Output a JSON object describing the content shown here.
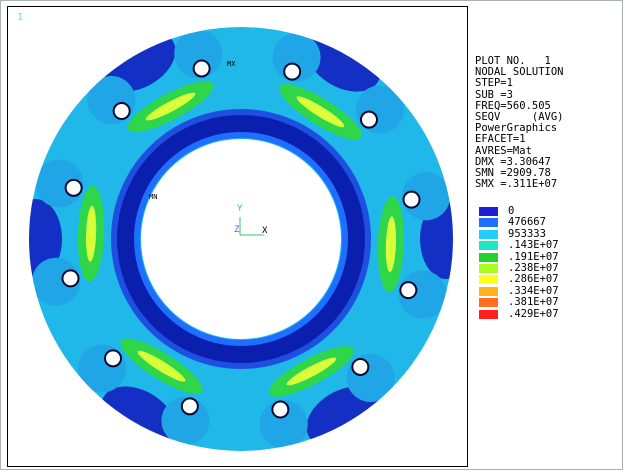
{
  "window_number": "1",
  "annotations": {
    "max_label": "MX",
    "min_label": "MN"
  },
  "axes": {
    "y_label": "Y",
    "z_label": "Z",
    "x_label": "X"
  },
  "info_lines": [
    "PLOT NO.   1",
    "NODAL SOLUTION",
    "STEP=1",
    "SUB =3",
    "FREQ=560.505",
    "SEQV     (AVG)",
    "PowerGraphics",
    "EFACET=1",
    "AVRES=Mat",
    "DMX =3.30647",
    "SMN =2909.78",
    "SMX =.311E+07"
  ],
  "legend": [
    {
      "label": "0",
      "color": "#1f1fd6"
    },
    {
      "label": "476667",
      "color": "#1e6fff"
    },
    {
      "label": "953333",
      "color": "#1fd0ff"
    },
    {
      "label": ".143E+07",
      "color": "#1fe6c4"
    },
    {
      "label": ".191E+07",
      "color": "#23d12f"
    },
    {
      "label": ".238E+07",
      "color": "#a6ff1f"
    },
    {
      "label": ".286E+07",
      "color": "#ffff1f"
    },
    {
      "label": ".334E+07",
      "color": "#ffb41f"
    },
    {
      "label": ".381E+07",
      "color": "#ff6f1f"
    },
    {
      "label": ".429E+07",
      "color": "#ff1f1f"
    }
  ],
  "colors": {
    "ring_base": "#1fb8e8",
    "inner_rim_dark": "#0b1fae",
    "inner_rim_mid": "#1e4fe0",
    "outer_band": "#20a6e6",
    "dark_patch": "#1430c4",
    "hot_green": "#2fd64a",
    "hot_yellow": "#d8ff3a",
    "triad": "#39c66b"
  }
}
